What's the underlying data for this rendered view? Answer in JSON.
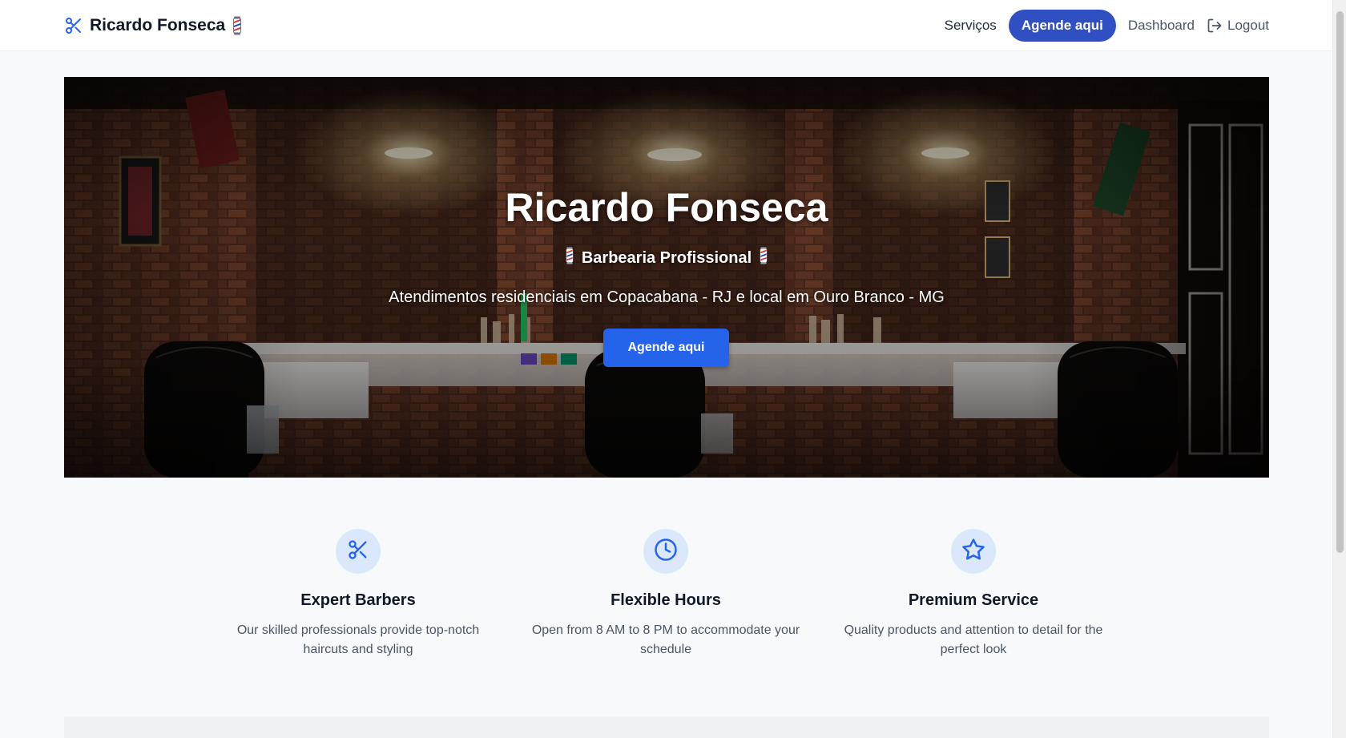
{
  "nav": {
    "brand": "Ricardo Fonseca",
    "brand_icon": "scissors-icon",
    "brand_emoji": "barber-pole-icon",
    "links": {
      "services": "Serviços",
      "book": "Agende aqui",
      "dashboard": "Dashboard",
      "logout": "Logout"
    }
  },
  "hero": {
    "title": "Ricardo Fonseca",
    "subtitle": "Barbearia Profissional",
    "description": "Atendimentos residenciais em Copacabana - RJ e local em Ouro Branco - MG",
    "cta": "Agende aqui"
  },
  "features": [
    {
      "icon": "scissors-icon",
      "title": "Expert Barbers",
      "text": "Our skilled professionals provide top-notch haircuts and styling"
    },
    {
      "icon": "clock-icon",
      "title": "Flexible Hours",
      "text": "Open from 8 AM to 8 PM to accommodate your schedule"
    },
    {
      "icon": "star-icon",
      "title": "Premium Service",
      "text": "Quality products and attention to detail for the perfect look"
    }
  ],
  "colors": {
    "primary": "#2563eb",
    "nav_cta": "#2f4fc2",
    "icon_bg": "#dbe8fb",
    "icon_stroke": "#2563eb"
  }
}
